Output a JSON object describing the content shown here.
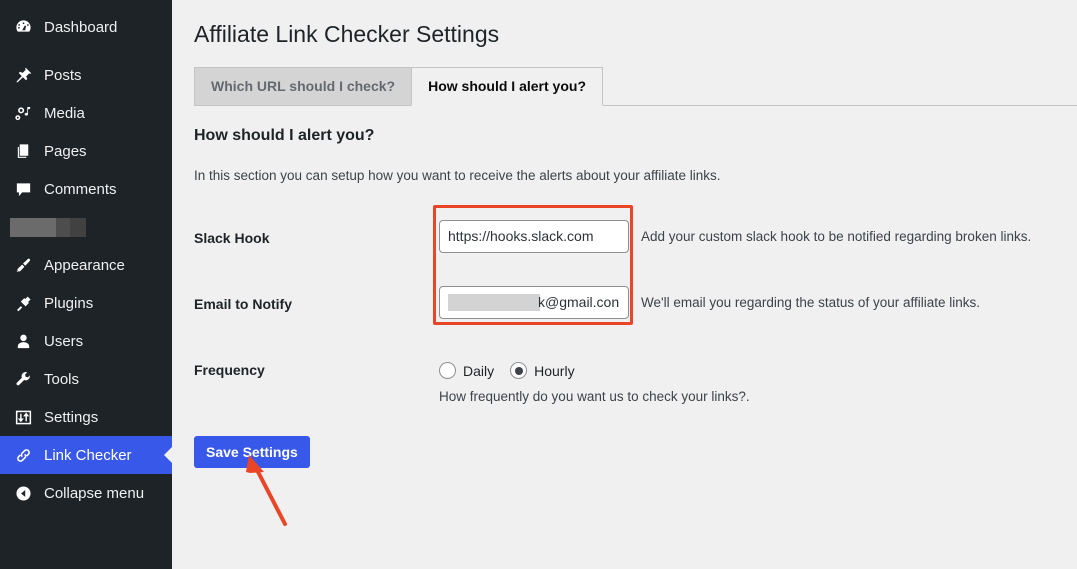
{
  "sidebar": {
    "items": [
      {
        "label": "Dashboard",
        "icon": "dashboard-icon",
        "active": false
      },
      {
        "label": "Posts",
        "icon": "pin-icon",
        "active": false
      },
      {
        "label": "Media",
        "icon": "media-icon",
        "active": false
      },
      {
        "label": "Pages",
        "icon": "pages-icon",
        "active": false
      },
      {
        "label": "Comments",
        "icon": "comment-icon",
        "active": false
      },
      {
        "label": "Appearance",
        "icon": "brush-icon",
        "active": false
      },
      {
        "label": "Plugins",
        "icon": "plug-icon",
        "active": false
      },
      {
        "label": "Users",
        "icon": "user-icon",
        "active": false
      },
      {
        "label": "Tools",
        "icon": "wrench-icon",
        "active": false
      },
      {
        "label": "Settings",
        "icon": "sliders-icon",
        "active": false
      },
      {
        "label": "Link Checker",
        "icon": "link-icon",
        "active": true
      },
      {
        "label": "Collapse menu",
        "icon": "collapse-left-icon",
        "active": false
      }
    ],
    "redacted_item_label": "",
    "active_color": "#3858e9",
    "background_color": "#1d2327"
  },
  "page": {
    "title": "Affiliate Link Checker Settings"
  },
  "tabs": [
    {
      "label": "Which URL should I check?",
      "active": false
    },
    {
      "label": "How should I alert you?",
      "active": true
    }
  ],
  "section": {
    "heading": "How should I alert you?",
    "description": "In this section you can setup how you want to receive the alerts about your affiliate links."
  },
  "fields": {
    "slack": {
      "label": "Slack Hook",
      "value": "https://hooks.slack.com",
      "help": "Add your custom slack hook to be notified regarding broken links."
    },
    "email": {
      "label": "Email to Notify",
      "value": "k@gmail.con",
      "redacted": true,
      "help": "We'll email you regarding the status of your affiliate links."
    },
    "frequency": {
      "label": "Frequency",
      "options": [
        {
          "label": "Daily",
          "selected": false
        },
        {
          "label": "Hourly",
          "selected": true
        }
      ],
      "help": "How frequently do you want us to check your links?."
    }
  },
  "actions": {
    "save_label": "Save Settings",
    "save_color": "#3858e9"
  },
  "annotations": {
    "highlight_color": "#ea4526",
    "box_target": "slack-and-email-inputs",
    "arrow_target": "save-settings-button"
  }
}
